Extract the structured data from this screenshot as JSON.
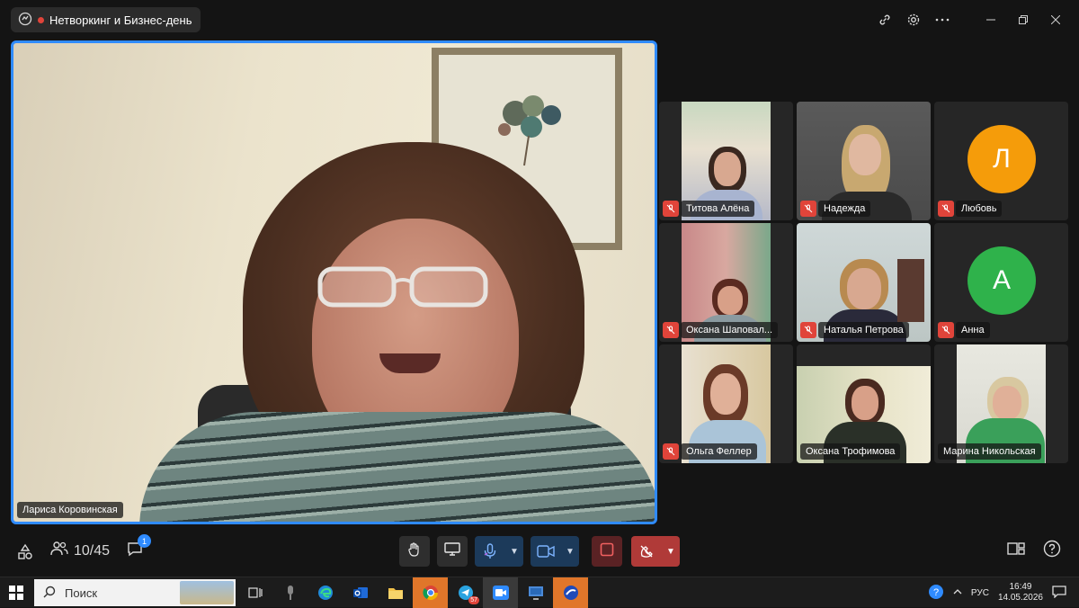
{
  "window": {
    "meeting_title": "Нетворкинг и Бизнес-день"
  },
  "speaker": {
    "name": "Лариса Коровинская"
  },
  "participants": [
    {
      "name": "Титова Алёна",
      "muted": true,
      "type": "video"
    },
    {
      "name": "Надежда",
      "muted": true,
      "type": "video"
    },
    {
      "name": "Любовь",
      "muted": true,
      "type": "avatar",
      "initial": "Л",
      "color": "#f59c0a"
    },
    {
      "name": "Оксана Шаповал...",
      "muted": true,
      "type": "video"
    },
    {
      "name": "Наталья Петрова",
      "muted": true,
      "type": "video"
    },
    {
      "name": "Анна",
      "muted": true,
      "type": "avatar",
      "initial": "А",
      "color": "#2fb24b"
    },
    {
      "name": "Ольга Феллер",
      "muted": true,
      "type": "video"
    },
    {
      "name": "Оксана Трофимова",
      "muted": false,
      "type": "video"
    },
    {
      "name": "Марина Никольская",
      "muted": false,
      "type": "video"
    }
  ],
  "toolbar": {
    "participants_count": "10/45",
    "chat_badge": "1"
  },
  "taskbar": {
    "search_placeholder": "Поиск",
    "language": "РУС",
    "time": "16:49",
    "date": "14.05.2026",
    "telegram_badge": "57"
  }
}
